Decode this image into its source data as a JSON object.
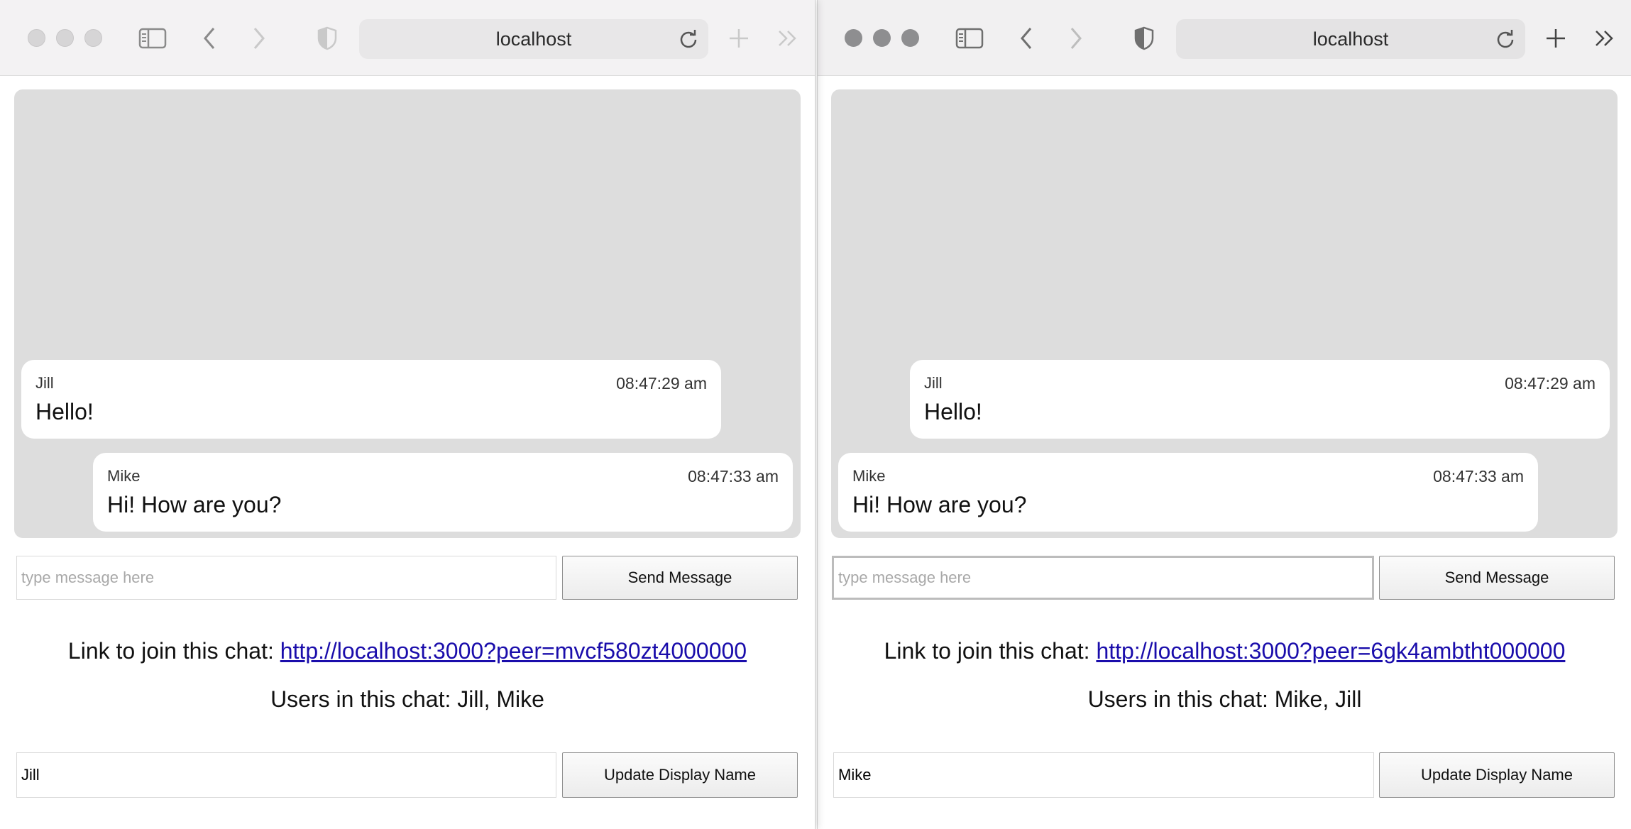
{
  "windows": {
    "left": {
      "url": "localhost",
      "messages": [
        {
          "name": "Jill",
          "time": "08:47:29 am",
          "text": "Hello!"
        },
        {
          "name": "Mike",
          "time": "08:47:33 am",
          "text": "Hi! How are you?"
        }
      ],
      "message_placeholder": "type message here",
      "send_label": "Send Message",
      "link_prefix": "Link to join this chat: ",
      "link": "http://localhost:3000?peer=mvcf580zt4000000",
      "users_line": "Users in this chat: Jill, Mike",
      "display_name_value": "Jill",
      "update_label": "Update Display Name"
    },
    "right": {
      "url": "localhost",
      "messages": [
        {
          "name": "Jill",
          "time": "08:47:29 am",
          "text": "Hello!"
        },
        {
          "name": "Mike",
          "time": "08:47:33 am",
          "text": "Hi! How are you?"
        }
      ],
      "message_placeholder": "type message here",
      "send_label": "Send Message",
      "link_prefix": "Link to join this chat: ",
      "link": "http://localhost:3000?peer=6gk4ambtht000000",
      "users_line": "Users in this chat: Mike, Jill",
      "display_name_value": "Mike",
      "update_label": "Update Display Name"
    }
  },
  "icons": [
    "sidebar-icon",
    "back-icon",
    "forward-icon",
    "shield-icon",
    "reload-icon",
    "new-tab-icon",
    "more-icon"
  ],
  "colors": {
    "link": "#1a0dab",
    "chat_bg": "#dddddd",
    "bubble_bg": "#ffffff"
  }
}
